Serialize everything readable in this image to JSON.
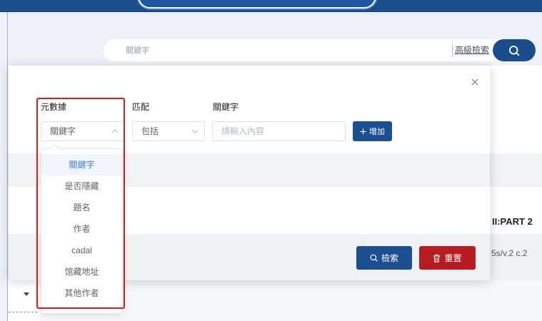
{
  "colors": {
    "header_blue": "#1b4d8e",
    "primary_button": "#1b4f91",
    "danger_button": "#b71c22",
    "option_active_text": "#3a7fd5",
    "annotation_red": "#e3191c",
    "page_background": "#eef2f8"
  },
  "search_bar": {
    "value": "",
    "placeholder": "關鍵字",
    "advanced_search_link": "高級檢索",
    "search_button_icon": "search-icon"
  },
  "advanced_search_dialog": {
    "close_icon": "close-icon",
    "columns": {
      "metadata": "元數據",
      "match": "匹配",
      "keyword": "關鍵字"
    },
    "metadata_select": {
      "selected": "關鍵字",
      "icon": "chevron-up-icon",
      "expanded": true
    },
    "match_select": {
      "selected": "包括",
      "icon": "chevron-down-icon",
      "expanded": false
    },
    "keyword_input": {
      "value": "",
      "placeholder": "請輸入內容"
    },
    "add_button": {
      "icon": "plus-icon",
      "label": "增加"
    },
    "metadata_options": [
      {
        "label": "關鍵字",
        "selected": true
      },
      {
        "label": "是否隱藏",
        "selected": false
      },
      {
        "label": "題名",
        "selected": false
      },
      {
        "label": "作者",
        "selected": false
      },
      {
        "label": "cadal",
        "selected": false
      },
      {
        "label": "馆藏地址",
        "selected": false
      },
      {
        "label": "其他作者",
        "selected": false
      }
    ],
    "footer": {
      "search_button": {
        "icon": "search-icon",
        "label": "檢索"
      },
      "reset_button": {
        "icon": "trash-icon",
        "label": "重置"
      }
    }
  },
  "background_results": {
    "title_fragment": "II:PART 2",
    "call_number_fragment": "5s/v.2 c.2"
  },
  "bottom_left": {
    "toggle_icon": "caret-down-icon"
  }
}
